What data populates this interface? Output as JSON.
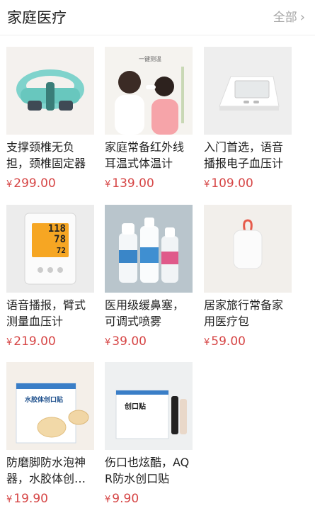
{
  "header": {
    "title": "家庭医疗",
    "more_label": "全部"
  },
  "products": [
    {
      "name": "支撑颈椎无负担，颈椎固定器",
      "currency": "¥",
      "price": "299.00",
      "icon": "neck-brace-image"
    },
    {
      "name": "家庭常备红外线耳温式体温计",
      "currency": "¥",
      "price": "139.00",
      "icon": "ear-thermometer-image",
      "image_caption": "一键测温"
    },
    {
      "name": "入门首选，语音播报电子血压计",
      "currency": "¥",
      "price": "109.00",
      "icon": "blood-pressure-monitor-image"
    },
    {
      "name": "语音播报，臂式测量血压计",
      "currency": "¥",
      "price": "219.00",
      "icon": "arm-blood-pressure-monitor-image",
      "display_top": "118",
      "display_mid": "78",
      "display_bot": "72"
    },
    {
      "name": "医用级缓鼻塞，可调式喷雾",
      "currency": "¥",
      "price": "39.00",
      "icon": "nasal-spray-image"
    },
    {
      "name": "居家旅行常备家用医疗包",
      "currency": "¥",
      "price": "59.00",
      "icon": "medical-pouch-image"
    },
    {
      "name": "防磨脚防水泡神器，水胶体创可贴",
      "currency": "¥",
      "price": "19.90",
      "icon": "blister-plaster-image",
      "box_label": "水胶体创口贴"
    },
    {
      "name": "伤口也炫酷，AQR防水创口贴",
      "currency": "¥",
      "price": "9.90",
      "icon": "band-aid-box-image",
      "box_label": "创口贴"
    }
  ]
}
